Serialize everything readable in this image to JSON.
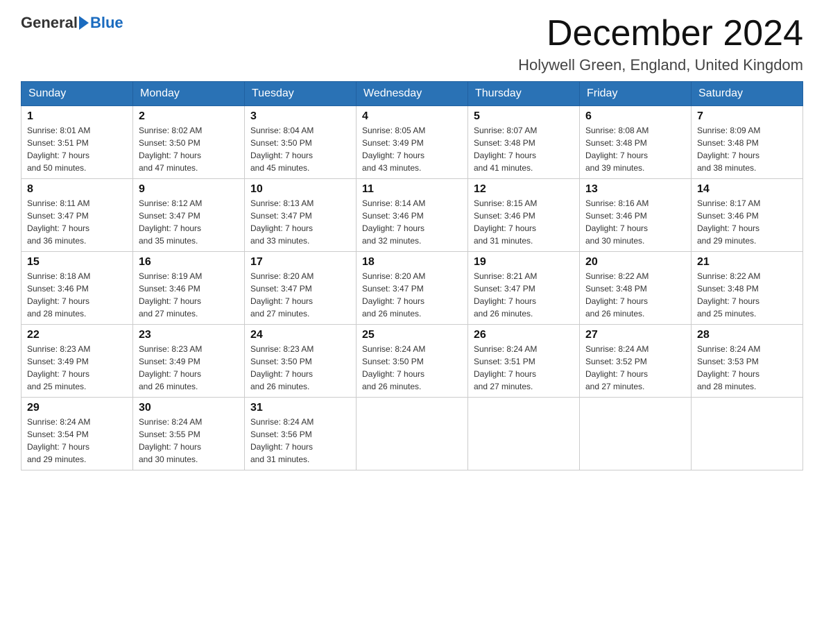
{
  "header": {
    "logo_general": "General",
    "logo_blue": "Blue",
    "month_title": "December 2024",
    "location": "Holywell Green, England, United Kingdom"
  },
  "days_of_week": [
    "Sunday",
    "Monday",
    "Tuesday",
    "Wednesday",
    "Thursday",
    "Friday",
    "Saturday"
  ],
  "weeks": [
    [
      {
        "day": "1",
        "sunrise": "Sunrise: 8:01 AM",
        "sunset": "Sunset: 3:51 PM",
        "daylight": "Daylight: 7 hours",
        "minutes": "and 50 minutes."
      },
      {
        "day": "2",
        "sunrise": "Sunrise: 8:02 AM",
        "sunset": "Sunset: 3:50 PM",
        "daylight": "Daylight: 7 hours",
        "minutes": "and 47 minutes."
      },
      {
        "day": "3",
        "sunrise": "Sunrise: 8:04 AM",
        "sunset": "Sunset: 3:50 PM",
        "daylight": "Daylight: 7 hours",
        "minutes": "and 45 minutes."
      },
      {
        "day": "4",
        "sunrise": "Sunrise: 8:05 AM",
        "sunset": "Sunset: 3:49 PM",
        "daylight": "Daylight: 7 hours",
        "minutes": "and 43 minutes."
      },
      {
        "day": "5",
        "sunrise": "Sunrise: 8:07 AM",
        "sunset": "Sunset: 3:48 PM",
        "daylight": "Daylight: 7 hours",
        "minutes": "and 41 minutes."
      },
      {
        "day": "6",
        "sunrise": "Sunrise: 8:08 AM",
        "sunset": "Sunset: 3:48 PM",
        "daylight": "Daylight: 7 hours",
        "minutes": "and 39 minutes."
      },
      {
        "day": "7",
        "sunrise": "Sunrise: 8:09 AM",
        "sunset": "Sunset: 3:48 PM",
        "daylight": "Daylight: 7 hours",
        "minutes": "and 38 minutes."
      }
    ],
    [
      {
        "day": "8",
        "sunrise": "Sunrise: 8:11 AM",
        "sunset": "Sunset: 3:47 PM",
        "daylight": "Daylight: 7 hours",
        "minutes": "and 36 minutes."
      },
      {
        "day": "9",
        "sunrise": "Sunrise: 8:12 AM",
        "sunset": "Sunset: 3:47 PM",
        "daylight": "Daylight: 7 hours",
        "minutes": "and 35 minutes."
      },
      {
        "day": "10",
        "sunrise": "Sunrise: 8:13 AM",
        "sunset": "Sunset: 3:47 PM",
        "daylight": "Daylight: 7 hours",
        "minutes": "and 33 minutes."
      },
      {
        "day": "11",
        "sunrise": "Sunrise: 8:14 AM",
        "sunset": "Sunset: 3:46 PM",
        "daylight": "Daylight: 7 hours",
        "minutes": "and 32 minutes."
      },
      {
        "day": "12",
        "sunrise": "Sunrise: 8:15 AM",
        "sunset": "Sunset: 3:46 PM",
        "daylight": "Daylight: 7 hours",
        "minutes": "and 31 minutes."
      },
      {
        "day": "13",
        "sunrise": "Sunrise: 8:16 AM",
        "sunset": "Sunset: 3:46 PM",
        "daylight": "Daylight: 7 hours",
        "minutes": "and 30 minutes."
      },
      {
        "day": "14",
        "sunrise": "Sunrise: 8:17 AM",
        "sunset": "Sunset: 3:46 PM",
        "daylight": "Daylight: 7 hours",
        "minutes": "and 29 minutes."
      }
    ],
    [
      {
        "day": "15",
        "sunrise": "Sunrise: 8:18 AM",
        "sunset": "Sunset: 3:46 PM",
        "daylight": "Daylight: 7 hours",
        "minutes": "and 28 minutes."
      },
      {
        "day": "16",
        "sunrise": "Sunrise: 8:19 AM",
        "sunset": "Sunset: 3:46 PM",
        "daylight": "Daylight: 7 hours",
        "minutes": "and 27 minutes."
      },
      {
        "day": "17",
        "sunrise": "Sunrise: 8:20 AM",
        "sunset": "Sunset: 3:47 PM",
        "daylight": "Daylight: 7 hours",
        "minutes": "and 27 minutes."
      },
      {
        "day": "18",
        "sunrise": "Sunrise: 8:20 AM",
        "sunset": "Sunset: 3:47 PM",
        "daylight": "Daylight: 7 hours",
        "minutes": "and 26 minutes."
      },
      {
        "day": "19",
        "sunrise": "Sunrise: 8:21 AM",
        "sunset": "Sunset: 3:47 PM",
        "daylight": "Daylight: 7 hours",
        "minutes": "and 26 minutes."
      },
      {
        "day": "20",
        "sunrise": "Sunrise: 8:22 AM",
        "sunset": "Sunset: 3:48 PM",
        "daylight": "Daylight: 7 hours",
        "minutes": "and 26 minutes."
      },
      {
        "day": "21",
        "sunrise": "Sunrise: 8:22 AM",
        "sunset": "Sunset: 3:48 PM",
        "daylight": "Daylight: 7 hours",
        "minutes": "and 25 minutes."
      }
    ],
    [
      {
        "day": "22",
        "sunrise": "Sunrise: 8:23 AM",
        "sunset": "Sunset: 3:49 PM",
        "daylight": "Daylight: 7 hours",
        "minutes": "and 25 minutes."
      },
      {
        "day": "23",
        "sunrise": "Sunrise: 8:23 AM",
        "sunset": "Sunset: 3:49 PM",
        "daylight": "Daylight: 7 hours",
        "minutes": "and 26 minutes."
      },
      {
        "day": "24",
        "sunrise": "Sunrise: 8:23 AM",
        "sunset": "Sunset: 3:50 PM",
        "daylight": "Daylight: 7 hours",
        "minutes": "and 26 minutes."
      },
      {
        "day": "25",
        "sunrise": "Sunrise: 8:24 AM",
        "sunset": "Sunset: 3:50 PM",
        "daylight": "Daylight: 7 hours",
        "minutes": "and 26 minutes."
      },
      {
        "day": "26",
        "sunrise": "Sunrise: 8:24 AM",
        "sunset": "Sunset: 3:51 PM",
        "daylight": "Daylight: 7 hours",
        "minutes": "and 27 minutes."
      },
      {
        "day": "27",
        "sunrise": "Sunrise: 8:24 AM",
        "sunset": "Sunset: 3:52 PM",
        "daylight": "Daylight: 7 hours",
        "minutes": "and 27 minutes."
      },
      {
        "day": "28",
        "sunrise": "Sunrise: 8:24 AM",
        "sunset": "Sunset: 3:53 PM",
        "daylight": "Daylight: 7 hours",
        "minutes": "and 28 minutes."
      }
    ],
    [
      {
        "day": "29",
        "sunrise": "Sunrise: 8:24 AM",
        "sunset": "Sunset: 3:54 PM",
        "daylight": "Daylight: 7 hours",
        "minutes": "and 29 minutes."
      },
      {
        "day": "30",
        "sunrise": "Sunrise: 8:24 AM",
        "sunset": "Sunset: 3:55 PM",
        "daylight": "Daylight: 7 hours",
        "minutes": "and 30 minutes."
      },
      {
        "day": "31",
        "sunrise": "Sunrise: 8:24 AM",
        "sunset": "Sunset: 3:56 PM",
        "daylight": "Daylight: 7 hours",
        "minutes": "and 31 minutes."
      },
      null,
      null,
      null,
      null
    ]
  ]
}
